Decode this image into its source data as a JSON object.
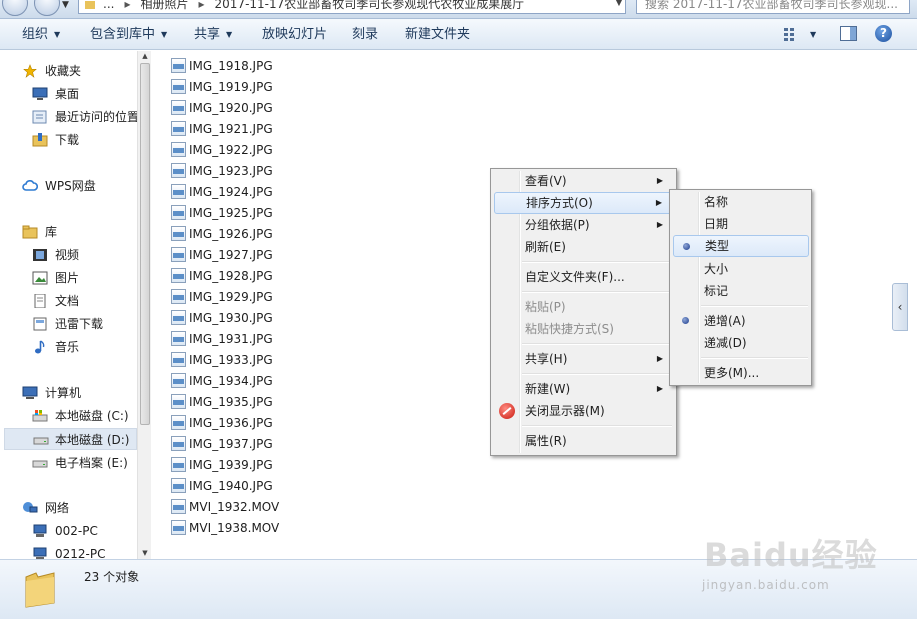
{
  "address_bar": {
    "path": [
      "...",
      "相册照片",
      "2017-11-17农业部畜牧司季司长参观现代农牧业成果展厅"
    ],
    "search_placeholder": "搜索 2017-11-17农业部畜牧司季司长参观现..."
  },
  "toolbar": {
    "organize": "组织",
    "include_in_library": "包含到库中",
    "share": "共享",
    "slideshow": "放映幻灯片",
    "burn": "刻录",
    "new_folder": "新建文件夹",
    "help": "?"
  },
  "nav": {
    "favorites": "收藏夹",
    "desktop": "桌面",
    "recent": "最近访问的位置",
    "downloads": "下载",
    "wps": "WPS网盘",
    "libraries": "库",
    "videos": "视频",
    "pictures": "图片",
    "documents": "文档",
    "thunder": "迅雷下载",
    "music": "音乐",
    "computer": "计算机",
    "drive_c": "本地磁盘 (C:)",
    "drive_d": "本地磁盘 (D:)",
    "drive_e": "电子档案 (E:)",
    "network": "网络",
    "pc1": "002-PC",
    "pc2": "0212-PC"
  },
  "files": [
    "IMG_1918.JPG",
    "IMG_1919.JPG",
    "IMG_1920.JPG",
    "IMG_1921.JPG",
    "IMG_1922.JPG",
    "IMG_1923.JPG",
    "IMG_1924.JPG",
    "IMG_1925.JPG",
    "IMG_1926.JPG",
    "IMG_1927.JPG",
    "IMG_1928.JPG",
    "IMG_1929.JPG",
    "IMG_1930.JPG",
    "IMG_1931.JPG",
    "IMG_1933.JPG",
    "IMG_1934.JPG",
    "IMG_1935.JPG",
    "IMG_1936.JPG",
    "IMG_1937.JPG",
    "IMG_1939.JPG",
    "IMG_1940.JPG",
    "MVI_1932.MOV",
    "MVI_1938.MOV"
  ],
  "context_menu": {
    "view": "查看(V)",
    "sort_by": "排序方式(O)",
    "group_by": "分组依据(P)",
    "refresh": "刷新(E)",
    "customize": "自定义文件夹(F)...",
    "paste": "粘贴(P)",
    "paste_shortcut": "粘贴快捷方式(S)",
    "share": "共享(H)",
    "new": "新建(W)",
    "close_display": "关闭显示器(M)",
    "properties": "属性(R)"
  },
  "sort_submenu": {
    "name": "名称",
    "date": "日期",
    "type": "类型",
    "size": "大小",
    "tags": "标记",
    "ascending": "递增(A)",
    "descending": "递减(D)",
    "more": "更多(M)...",
    "selected_field": "类型",
    "selected_order": "递增(A)"
  },
  "status": {
    "count_text": "23 个对象"
  },
  "watermark": {
    "brand": "Baidu经验",
    "url": "jingyan.baidu.com"
  },
  "colors": {
    "toolbar_text": "#1e395b",
    "menu_highlight_border": "#a8c8ed",
    "folder_yellow": "#e9c35b"
  }
}
